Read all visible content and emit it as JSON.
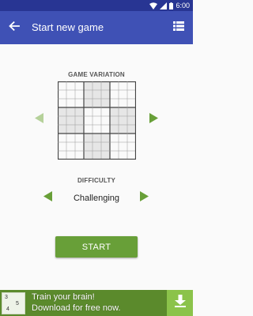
{
  "status_bar": {
    "time": "6:00",
    "icons": [
      "wifi-icon",
      "signal-icon",
      "battery-icon"
    ]
  },
  "app_bar": {
    "title": "Start new game",
    "back_icon": "arrow-left-icon",
    "menu_icon": "list-icon"
  },
  "game_variation": {
    "label": "GAME VARIATION",
    "grid_size": 9,
    "prev_icon": "triangle-left-icon",
    "next_icon": "triangle-right-icon"
  },
  "difficulty": {
    "label": "DIFFICULTY",
    "value": "Challenging",
    "prev_icon": "triangle-left-icon",
    "next_icon": "triangle-right-icon"
  },
  "start_button": {
    "label": "START"
  },
  "ad": {
    "line1": "Train your brain!",
    "line2": "Download for free now.",
    "app_icon_digits": [
      "3",
      "5",
      "4"
    ],
    "download_icon": "download-icon"
  },
  "colors": {
    "status_bar": "#283593",
    "app_bar": "#3f51b5",
    "accent_green": "#689f38",
    "arrow_active": "#689f38",
    "arrow_inactive": "#b5d19a",
    "grid_shade": "#e6e6e6",
    "ad_background": "#5b8a2c",
    "ad_download": "#8bc34a"
  }
}
